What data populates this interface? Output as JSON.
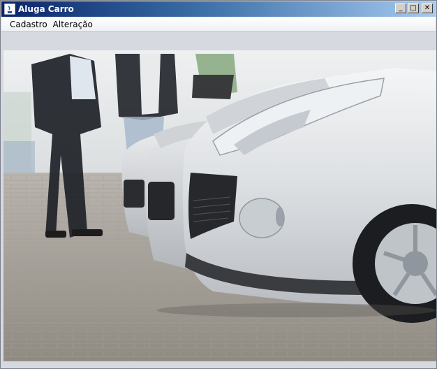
{
  "window": {
    "title": "Aluga Carro",
    "controls": {
      "minimize": "_",
      "maximize": "□",
      "close": "✕"
    }
  },
  "menu": {
    "items": [
      {
        "label": "Cadastro"
      },
      {
        "label": "Alteração"
      }
    ]
  },
  "content": {
    "image_subject": "silver-cars-lineup-with-people"
  },
  "colors": {
    "titlebar_start": "#0a246a",
    "titlebar_end": "#a6caf0",
    "window_bg": "#d6d9df"
  }
}
